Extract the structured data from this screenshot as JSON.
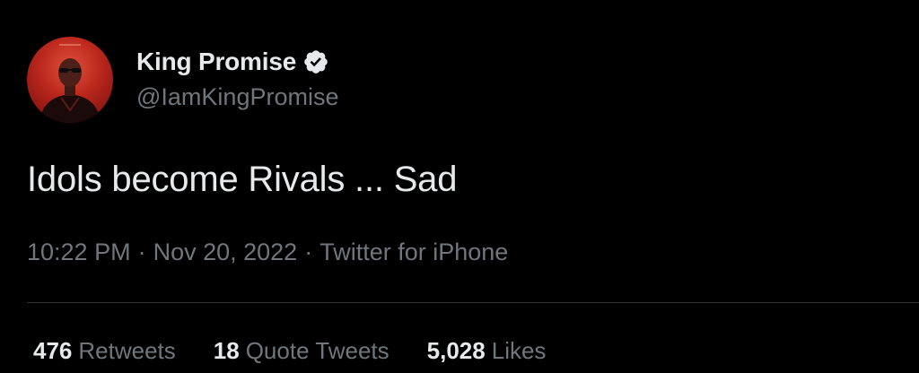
{
  "colors": {
    "background": "#000000",
    "primary_text": "#e7e9ea",
    "secondary_text": "#71767b",
    "divider": "#2f3336",
    "avatar_bg": "#b8261c"
  },
  "author": {
    "display_name": "King Promise",
    "handle": "@IamKingPromise",
    "verified_icon": "verified-badge-icon"
  },
  "tweet": {
    "text": "Idols become Rivals ... Sad",
    "time": "10:22 PM",
    "separator": "·",
    "date": "Nov 20, 2022",
    "source": "Twitter for iPhone"
  },
  "stats": [
    {
      "count": "476",
      "label": "Retweets"
    },
    {
      "count": "18",
      "label": "Quote Tweets"
    },
    {
      "count": "5,028",
      "label": "Likes"
    }
  ]
}
